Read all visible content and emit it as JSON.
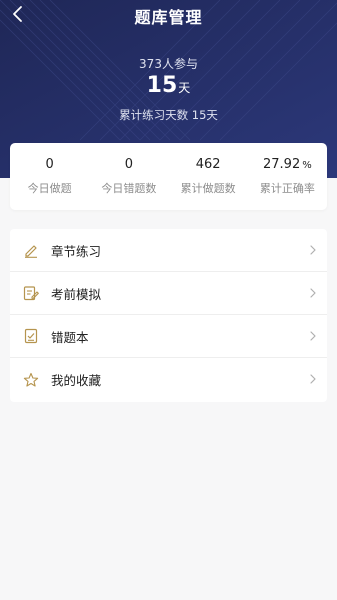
{
  "header": {
    "title": "题库管理",
    "participants": "373人参与",
    "days_value": "15",
    "days_unit": "天",
    "cumulative_days": "累计练习天数  15天",
    "bg_color": "#273169"
  },
  "stats": [
    {
      "value": "0",
      "label": "今日做题"
    },
    {
      "value": "0",
      "label": "今日错题数"
    },
    {
      "value": "462",
      "label": "累计做题数"
    },
    {
      "value": "27.92",
      "unit": "%",
      "label": "累计正确率"
    }
  ],
  "menu": [
    {
      "label": "章节练习",
      "icon": "pencil-icon"
    },
    {
      "label": "考前模拟",
      "icon": "edit-document-icon"
    },
    {
      "label": "错题本",
      "icon": "checklist-icon"
    },
    {
      "label": "我的收藏",
      "icon": "star-icon"
    }
  ],
  "colors": {
    "accent_icon": "#b5944e",
    "text": "#222222",
    "muted": "#8d8d8d"
  }
}
